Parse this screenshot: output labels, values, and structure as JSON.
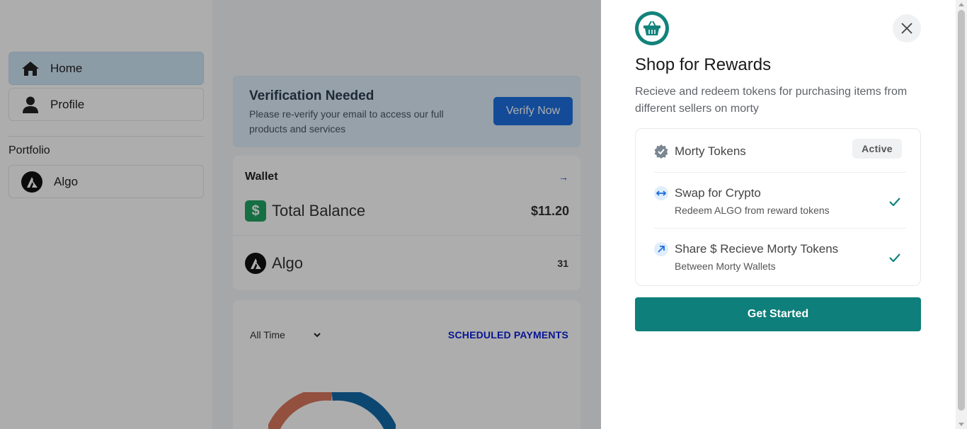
{
  "sidebar": {
    "items": [
      {
        "label": "Home",
        "icon": "home-icon"
      },
      {
        "label": "Profile",
        "icon": "user-icon"
      }
    ],
    "section_title": "Portfolio",
    "portfolio_items": [
      {
        "label": "Algo",
        "icon": "algorand-logo-icon"
      }
    ]
  },
  "verification": {
    "title": "Verification Needed",
    "text": "Please re-verify your email to access our full products and services",
    "button": "Verify Now"
  },
  "wallet": {
    "title": "Wallet",
    "total_label": "Total Balance",
    "total_value": "$11.20",
    "assets": [
      {
        "label": "Algo",
        "value": "31"
      }
    ]
  },
  "chart_panel": {
    "filter_value": "All Time",
    "link": "SCHEDULED PAYMENTS"
  },
  "drawer": {
    "title": "Shop for Rewards",
    "description": "Recieve and redeem tokens for purchasing items from different sellers on morty",
    "features": [
      {
        "title": "Morty Tokens",
        "badge": "Active",
        "icon": "verified-badge-icon"
      },
      {
        "title": "Swap for Crypto",
        "subtitle": "Redeem ALGO from reward tokens",
        "icon": "swap-arrows-icon"
      },
      {
        "title": "Share $ Recieve Morty Tokens",
        "subtitle": "Between Morty Wallets",
        "icon": "share-arrow-icon"
      }
    ],
    "cta": "Get Started"
  },
  "colors": {
    "accent": "#0e7f7a",
    "primary_button": "#1d6fe0",
    "link": "#0a1fd8",
    "success": "#1fa463"
  }
}
